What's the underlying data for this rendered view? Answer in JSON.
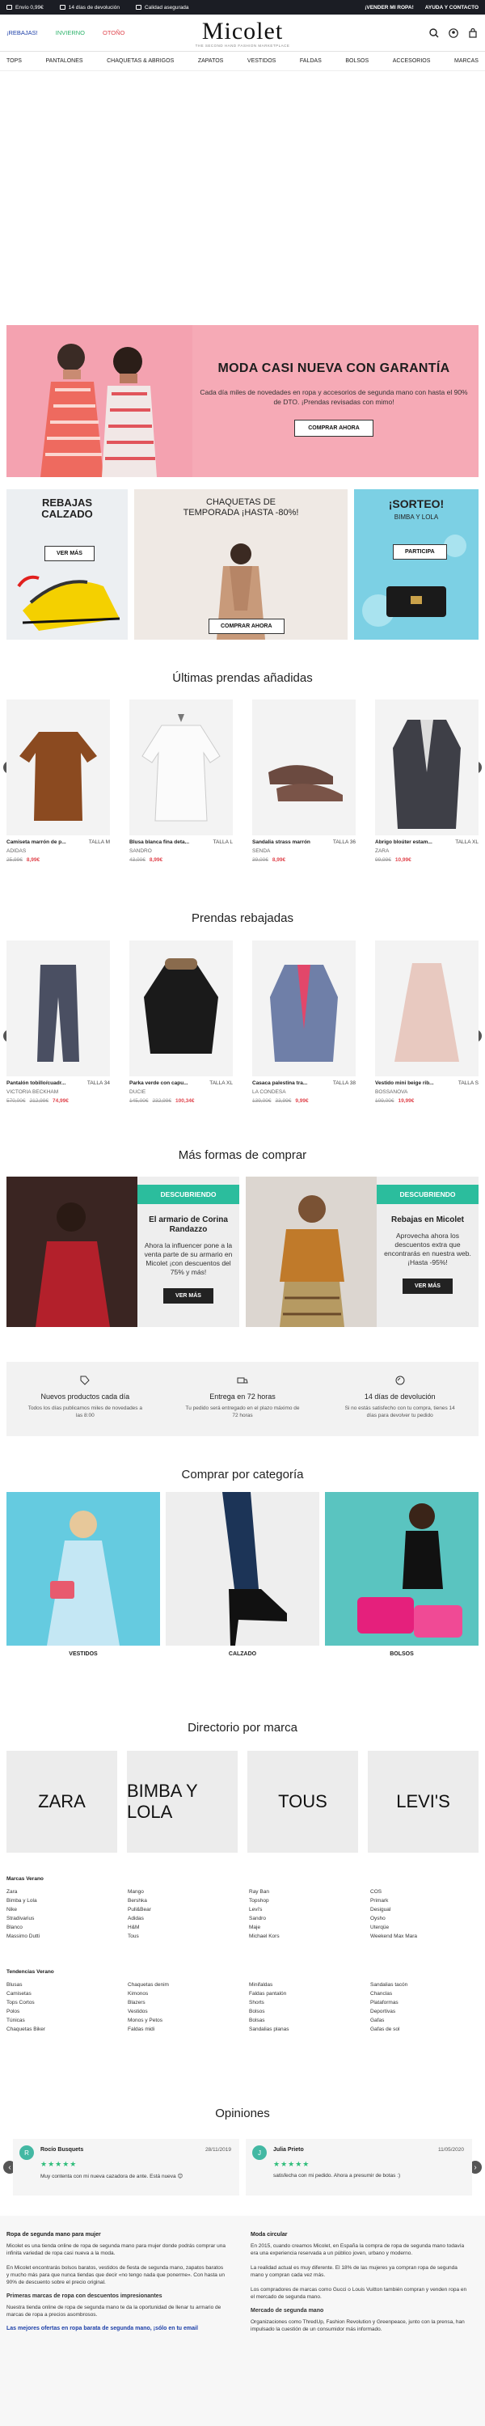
{
  "topbar": {
    "items": [
      "Envío 0,99€",
      "14 días de devolución",
      "Calidad asegurada"
    ],
    "right": [
      "¡VENDER MI ROPA!",
      "AYUDA Y CONTACTO"
    ]
  },
  "header": {
    "seasons": [
      "¡REBAJAS!",
      "INVIERNO",
      "OTOÑO"
    ],
    "logo": "Micolet",
    "logo_tag": "THE SECOND HAND FASHION MARKETPLACE"
  },
  "nav": [
    "TOPS",
    "PANTALONES",
    "CHAQUETAS & ABRIGOS",
    "ZAPATOS",
    "VESTIDOS",
    "FALDAS",
    "BOLSOS",
    "ACCESORIOS",
    "MARCAS"
  ],
  "hero": {
    "title": "MODA CASI NUEVA CON GARANTÍA",
    "text": "Cada día miles de novedades en ropa y accesorios de segunda mano con hasta el 90% de DTO. ¡Prendas revisadas con mimo!",
    "button": "COMPRAR AHORA"
  },
  "promos": [
    {
      "title": "REBAJAS CALZADO",
      "button": "VER MÁS"
    },
    {
      "title": "CHAQUETAS DE TEMPORADA ¡HASTA -80%!",
      "button": "COMPRAR AHORA"
    },
    {
      "title": "¡SORTEO!",
      "subtitle": "BIMBA Y LOLA",
      "button": "PARTICIPA"
    }
  ],
  "latest": {
    "title": "Últimas prendas añadidas",
    "items": [
      {
        "name": "Camiseta marrón de p...",
        "size": "TALLA M",
        "brand": "ADIDAS",
        "old": "25,99€",
        "price": "8,99€"
      },
      {
        "name": "Blusa blanca fina deta...",
        "size": "TALLA L",
        "brand": "SANDRO",
        "old": "43,00€",
        "price": "8,99€"
      },
      {
        "name": "Sandalia strass marrón",
        "size": "TALLA 36",
        "brand": "SENDA",
        "old": "39,00€",
        "price": "8,99€"
      },
      {
        "name": "Abrigo bloúter estam...",
        "size": "TALLA XL",
        "brand": "ZARA",
        "old": "99,99€",
        "price": "10,99€"
      }
    ]
  },
  "sale": {
    "title": "Prendas rebajadas",
    "items": [
      {
        "name": "Pantalón tobillo/cuadr...",
        "size": "TALLA 34",
        "brand": "VICTORIA BECKHAM",
        "old": "570,00€",
        "was": "212,99€",
        "price": "74,99€"
      },
      {
        "name": "Parka verde con capu...",
        "size": "TALLA XL",
        "brand": "DUCIE",
        "old": "145,00€",
        "was": "232,99€",
        "price": "100,34€"
      },
      {
        "name": "Casaca palestina tra...",
        "size": "TALLA 38",
        "brand": "LA CONDESA",
        "old": "139,00€",
        "was": "33,99€",
        "price": "9,99€"
      },
      {
        "name": "Vestido mini beige rib...",
        "size": "TALLA S",
        "brand": "BOSSANOVA",
        "old": "109,00€",
        "was": "",
        "price": "19,99€"
      }
    ]
  },
  "moreways": {
    "title": "Más formas de comprar",
    "cards": [
      {
        "badge": "DESCUBRIENDO",
        "heading": "El armario de Corina Randazzo",
        "text": "Ahora la influencer pone a la venta parte de su armario en Micolet ¡con descuentos del 75% y más!",
        "button": "VER MÁS"
      },
      {
        "badge": "DESCUBRIENDO",
        "heading": "Rebajas en Micolet",
        "text": "Aprovecha ahora los descuentos extra que encontrarás en nuestra web. ¡Hasta -95%!",
        "button": "VER MÁS"
      }
    ]
  },
  "features": [
    {
      "title": "Nuevos productos cada día",
      "text": "Todos los días publicamos miles de novedades a las 8:00"
    },
    {
      "title": "Entrega en 72 horas",
      "text": "Tu pedido será entregado en el plazo máximo de 72 horas"
    },
    {
      "title": "14 días de devolución",
      "text": "Si no estás satisfecho con tu compra, tienes 14 días para devolver tu pedido"
    }
  ],
  "categories": {
    "title": "Comprar por categoría",
    "items": [
      "VESTIDOS",
      "CALZADO",
      "BOLSOS"
    ]
  },
  "brands": {
    "title": "Directorio por marca",
    "items": [
      "ZARA",
      "BIMBA Y LOLA",
      "TOUS",
      "LEVI'S"
    ]
  },
  "brand_list": {
    "title": "Marcas Verano",
    "cols": [
      [
        "Zara",
        "Bimba y Lola",
        "Nike",
        "Stradivarius",
        "Blanco",
        "Massimo Dutti"
      ],
      [
        "Mango",
        "Bershka",
        "Pull&Bear",
        "Adidas",
        "H&M",
        "Tous"
      ],
      [
        "Ray Ban",
        "Topshop",
        "Levi's",
        "Sandro",
        "Maje",
        "Michael Kors"
      ],
      [
        "COS",
        "Primark",
        "Desigual",
        "Oysho",
        "Uterqüe",
        "Weekend Max Mara"
      ]
    ]
  },
  "trend_list": {
    "title": "Tendencias Verano",
    "cols": [
      [
        "Blusas",
        "Camisetas",
        "Tops Cortos",
        "Polos",
        "Túnicas",
        "Chaquetas Biker"
      ],
      [
        "Chaquetas denim",
        "Kimonos",
        "Blazers",
        "Vestidos",
        "Monos y Petos",
        "Faldas midi"
      ],
      [
        "Minifaldas",
        "Faldas pantalón",
        "Shorts",
        "Bolsos",
        "Bolsas",
        "Sandalias planas"
      ],
      [
        "Sandalias tacón",
        "Chanclas",
        "Plataformas",
        "Deportivas",
        "Gafas",
        "Gafas de sol"
      ]
    ]
  },
  "reviews": {
    "title": "Opiniones",
    "items": [
      {
        "initial": "R",
        "name": "Rocío Busquets",
        "date": "28/11/2019",
        "stars": "★★★★★",
        "text": "Muy contenta con mi nueva cazadora de ante. Está nueva 😊"
      },
      {
        "initial": "J",
        "name": "Julia Prieto",
        "date": "11/05/2020",
        "stars": "★★★★★",
        "text": "satisfecha con mi pedido. Ahora a presumir de botas :)"
      }
    ]
  },
  "footer": {
    "left_title": "Ropa de segunda mano para mujer",
    "left_paras": [
      "Micolet es una tienda online de ropa de segunda mano para mujer donde podrás comprar una infinita variedad de ropa casi nueva a la moda.",
      "En Micolet encontrarás bolsos baratos, vestidos de fiesta de segunda mano, zapatos baratos y mucho más para que nunca tiendas que decir «no tengo nada que ponerme». Con hasta un 90% de descuento sobre el precio original.",
      "Primeras marcas de ropa con descuentos impresionantes",
      "Nuestra tienda online de ropa de segunda mano te da la oportunidad de llenar tu armario de marcas de ropa a precios asombrosos.",
      "Las mejores ofertas en ropa barata de segunda mano, ¡sólo en tu email"
    ],
    "right_title": "Moda circular",
    "right_paras": [
      "En 2015, cuando creamos Micolet, en España la compra de ropa de segunda mano todavía era una experiencia reservada a un público joven, urbano y moderno.",
      "La realidad actual es muy diferente. El 18% de las mujeres ya compran ropa de segunda mano y compran cada vez más.",
      "Los compradores de marcas como Gucci o Louis Vuitton también compran y venden ropa en el mercado de segunda mano.",
      "Mercado de segunda mano",
      "Organizaciones como ThredUp, Fashion Revolution y Greenpeace, junto con la prensa, han impulsado la cuestión de un consumidor más informado."
    ]
  }
}
